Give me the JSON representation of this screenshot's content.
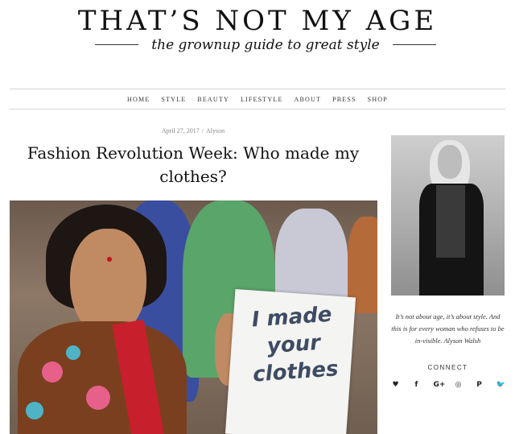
{
  "site": {
    "title": "THAT’S NOT MY AGE",
    "tagline": "the grownup guide to great style"
  },
  "nav": {
    "items": [
      "HOME",
      "STYLE",
      "BEAUTY",
      "LIFESTYLE",
      "ABOUT",
      "PRESS",
      "SHOP"
    ]
  },
  "post": {
    "date": "April 27, 2017",
    "separator": "/",
    "author": "Alyson",
    "title": "Fashion Revolution Week: Who made my clothes?",
    "image_sign_text": "I made your clothes"
  },
  "sidebar": {
    "bio": "It’s not about age, it’s about style. And this is for every woman who refuses to be in-visible. Alyson Walsh",
    "connect_label": "CONNECT",
    "social_icons": [
      {
        "name": "heart-icon",
        "glyph": "♥"
      },
      {
        "name": "facebook-icon",
        "glyph": "f"
      },
      {
        "name": "google-plus-icon",
        "glyph": "G+"
      },
      {
        "name": "instagram-icon",
        "glyph": "◎"
      },
      {
        "name": "pinterest-icon",
        "glyph": "P"
      },
      {
        "name": "twitter-icon",
        "glyph": "🐦"
      }
    ]
  }
}
